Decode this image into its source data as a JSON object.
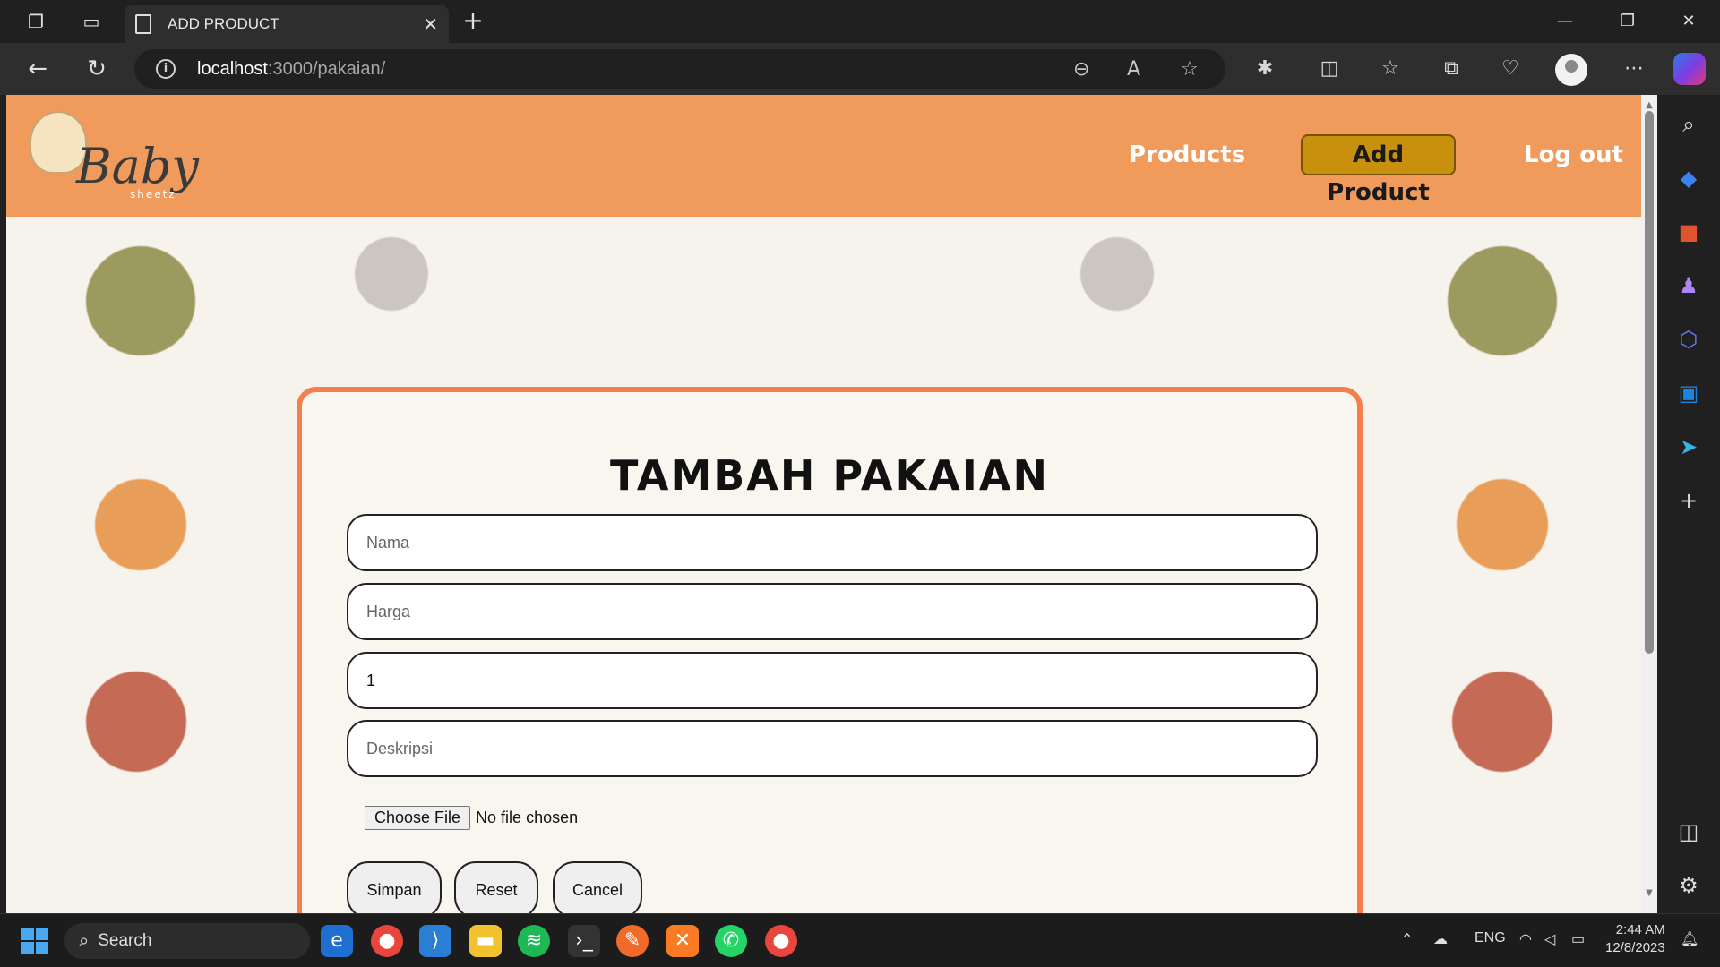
{
  "browser": {
    "tab_title": "ADD PRODUCT",
    "url_host": "localhost",
    "url_path": ":3000/pakaian/"
  },
  "site": {
    "logo_text": "Baby",
    "logo_subtext": "sheetz",
    "nav": {
      "products": "Products",
      "add_product": "Add Product",
      "logout": "Log out"
    }
  },
  "form": {
    "title": "TAMBAH PAKAIAN",
    "fields": {
      "nama_placeholder": "Nama",
      "harga_placeholder": "Harga",
      "qty_value": "1",
      "deskripsi_placeholder": "Deskripsi"
    },
    "file": {
      "button_label": "Choose File",
      "status": "No file chosen"
    },
    "buttons": {
      "simpan": "Simpan",
      "reset": "Reset",
      "cancel": "Cancel"
    }
  },
  "taskbar": {
    "search_label": "Search",
    "language": "ENG",
    "time": "2:44 AM",
    "date": "12/8/2023"
  },
  "colors": {
    "header_bg": "#f09b5c",
    "active_nav_bg": "#c9900e",
    "card_border": "#f47f4c"
  }
}
